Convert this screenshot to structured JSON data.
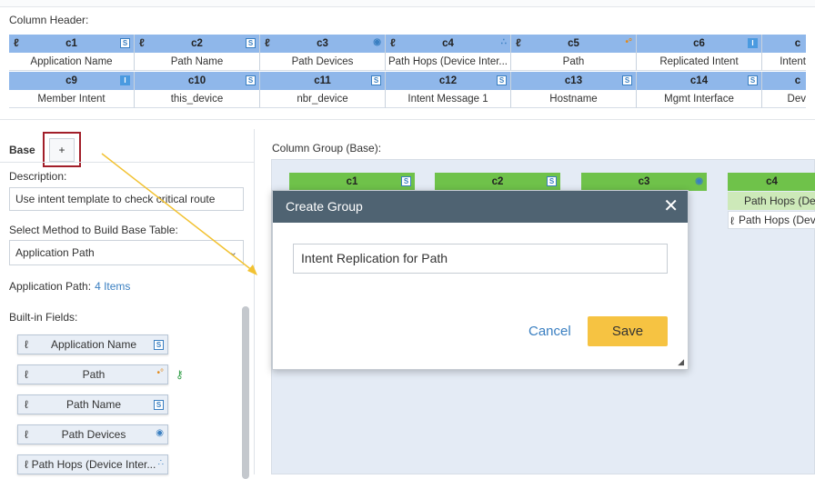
{
  "column_header": {
    "label": "Column Header:",
    "rows": [
      {
        "type": "hdr",
        "cells": [
          {
            "text": "c1",
            "link": true,
            "badge": "S"
          },
          {
            "text": "c2",
            "link": true,
            "badge": "S"
          },
          {
            "text": "c3",
            "link": true,
            "icon": "devices-icon"
          },
          {
            "text": "c4",
            "link": true,
            "icon": "hops-icon"
          },
          {
            "text": "c5",
            "link": true,
            "icon": "path-icon"
          },
          {
            "text": "c6",
            "link": false,
            "badge": "I"
          },
          {
            "text": "c",
            "link": false
          }
        ]
      },
      {
        "type": "val",
        "cells": [
          {
            "text": "Application Name"
          },
          {
            "text": "Path Name"
          },
          {
            "text": "Path Devices"
          },
          {
            "text": "Path Hops (Device Inter..."
          },
          {
            "text": "Path"
          },
          {
            "text": "Replicated Intent"
          },
          {
            "text": "Intent"
          }
        ]
      },
      {
        "type": "hdr",
        "cells": [
          {
            "text": "c9",
            "link": false,
            "badge": "I"
          },
          {
            "text": "c10",
            "link": false,
            "badge": "S"
          },
          {
            "text": "c11",
            "link": false,
            "badge": "S"
          },
          {
            "text": "c12",
            "link": false,
            "badge": "S"
          },
          {
            "text": "c13",
            "link": false,
            "badge": "S"
          },
          {
            "text": "c14",
            "link": false,
            "badge": "S"
          },
          {
            "text": "c",
            "link": false
          }
        ]
      },
      {
        "type": "val",
        "cells": [
          {
            "text": "Member Intent"
          },
          {
            "text": "this_device"
          },
          {
            "text": "nbr_device"
          },
          {
            "text": "Intent Message 1"
          },
          {
            "text": "Hostname"
          },
          {
            "text": "Mgmt Interface"
          },
          {
            "text": "Dev"
          }
        ]
      }
    ]
  },
  "left_panel": {
    "tab_base": "Base",
    "tab_add": "+",
    "description_label": "Description:",
    "description_value": "Use intent template to check critical route",
    "method_label": "Select Method to Build Base Table:",
    "method_value": "Application Path",
    "app_path_label": "Application Path:",
    "app_path_count": "4 Items",
    "builtin_label": "Built-in Fields:",
    "fields": [
      {
        "label": "Application Name",
        "badge": "S"
      },
      {
        "label": "Path",
        "icon": "path-icon"
      },
      {
        "label": "Path Name",
        "badge": "S"
      },
      {
        "label": "Path Devices",
        "icon": "devices-icon"
      },
      {
        "label": "Path Hops (Device Inter...",
        "icon": "hops-icon"
      }
    ]
  },
  "column_group": {
    "label": "Column Group (Base):",
    "columns": [
      {
        "text": "c1",
        "badge": "S"
      },
      {
        "text": "c2",
        "badge": "S"
      },
      {
        "text": "c3",
        "icon": "devices-icon"
      },
      {
        "text": "c4"
      }
    ],
    "c4_sub1": "Path Hops (Dev",
    "c4_sub2": "Path Hops (Devi"
  },
  "dialog": {
    "title": "Create Group",
    "input_value": "Intent Replication for Path",
    "cancel_label": "Cancel",
    "save_label": "Save"
  },
  "colors": {
    "header_blue": "#8fb7ea",
    "group_green": "#6fc24a",
    "dialog_header": "#4f6372",
    "save_yellow": "#f6c342",
    "highlight_red": "#a21f2a",
    "arrow_yellow": "#f2c232"
  }
}
